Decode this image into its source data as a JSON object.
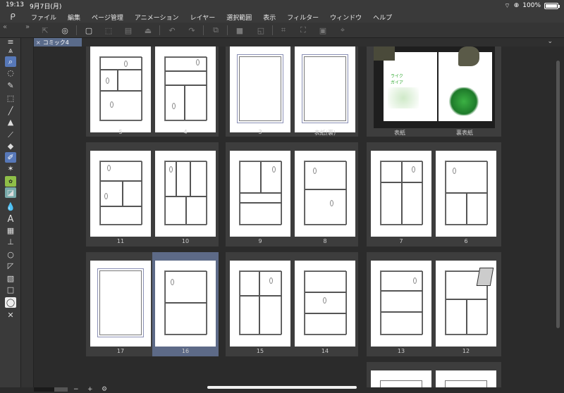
{
  "status_bar": {
    "time": "19:13",
    "date": "9月7日(月)",
    "battery": "100%",
    "battery_level": 1.0
  },
  "menu": {
    "items": [
      "ファイル",
      "編集",
      "ページ管理",
      "アニメーション",
      "レイヤー",
      "選択範囲",
      "表示",
      "フィルター",
      "ウィンドウ",
      "ヘルプ"
    ]
  },
  "tab": {
    "title": "コミック4"
  },
  "pages": {
    "row1": [
      "5",
      "4",
      "3",
      "表紙(裏)",
      "表紙",
      "裏表紙"
    ],
    "row2": [
      "11",
      "10",
      "9",
      "8",
      "7",
      "6"
    ],
    "row3": [
      "17",
      "16",
      "15",
      "14",
      "13",
      "12"
    ],
    "selected": "16"
  },
  "cover_text": "ライク\nガイア",
  "zoom": {
    "minus": "−",
    "plus": "+"
  }
}
